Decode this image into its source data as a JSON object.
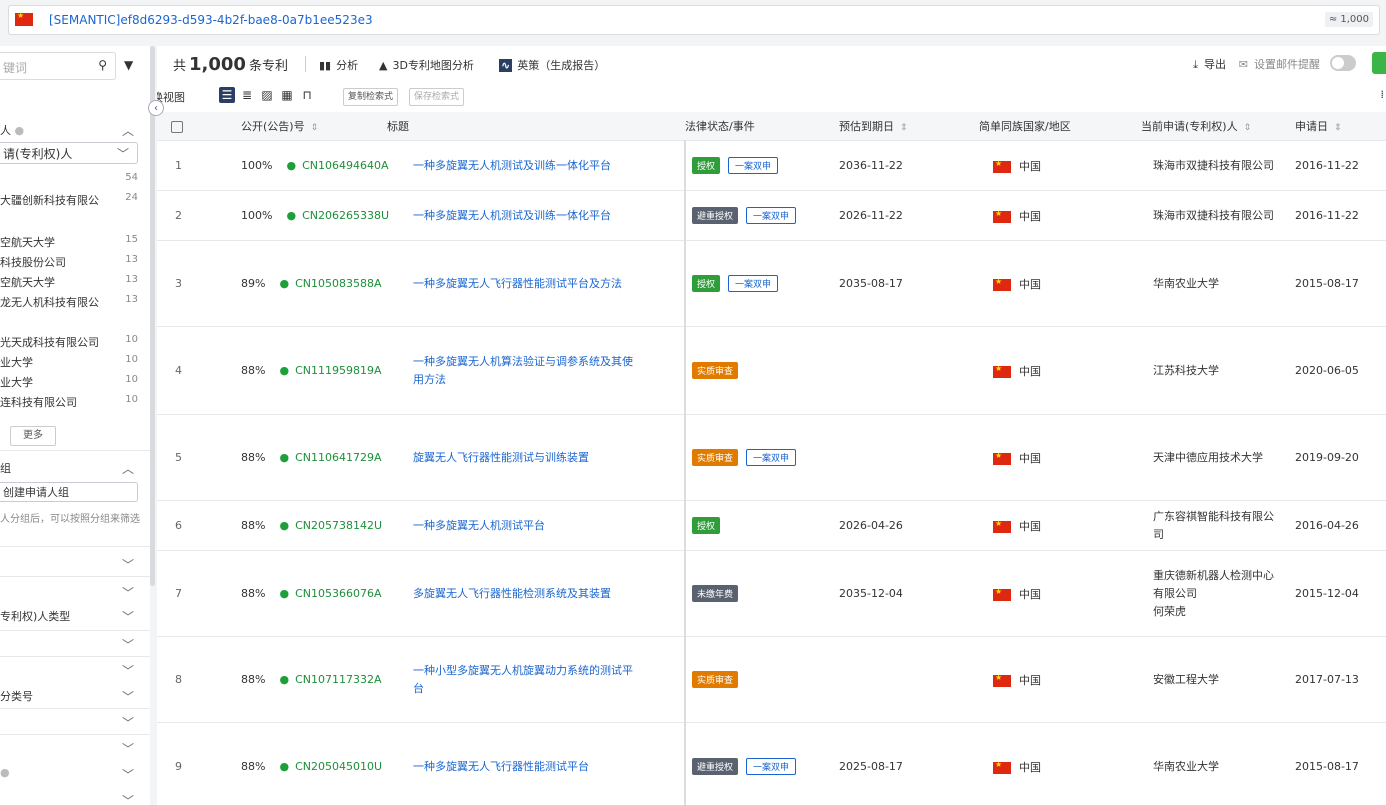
{
  "query": {
    "text": "[SEMANTIC]ef8d6293-d593-4b2f-bae8-0a7b1ee523e3",
    "count": "≈ 1,000"
  },
  "sidebar": {
    "search_placeholder": "键词",
    "section1_title": "人",
    "applicant_select": "请(专利权)人",
    "top_count": "54",
    "items": [
      {
        "label": "大疆创新科技有限公",
        "count": "24"
      },
      {
        "label": "空航天大学",
        "count": "15"
      },
      {
        "label": "科技股份公司",
        "count": "13"
      },
      {
        "label": "空航天大学",
        "count": "13"
      },
      {
        "label": "龙无人机科技有限公",
        "count": "13"
      },
      {
        "label": "光天成科技有限公司",
        "count": "10"
      },
      {
        "label": "业大学",
        "count": "10"
      },
      {
        "label": "业大学",
        "count": "10"
      },
      {
        "label": "连科技有限公司",
        "count": "10"
      }
    ],
    "more_label": "更多",
    "group_title": "组",
    "create_group": "创建申请人组",
    "group_hint": "人分组后，可以按照分组来筛选",
    "type_label": "专利权)人类型",
    "class_label": "分类号"
  },
  "toolbar": {
    "total_prefix": "共",
    "total_number": "1,000",
    "total_suffix": "条专利",
    "analysis": "分析",
    "map3d": "3D专利地图分析",
    "report": "英策（生成报告）",
    "export": "导出",
    "mail_alert": "设置邮件提醒",
    "switch_view": "切换视图",
    "copy_query": "复制检索式",
    "save_query": "保存检索式"
  },
  "table": {
    "headers": {
      "pub_no": "公开(公告)号",
      "title": "标题",
      "legal": "法律状态/事件",
      "expiry": "预估到期日",
      "country": "简单同族国家/地区",
      "applicant": "当前申请(专利权)人",
      "app_date": "申请日"
    },
    "rows": [
      {
        "idx": "1",
        "pct": "100%",
        "pn": "CN106494640A",
        "title": "一种多旋翼无人机测试及训练一体化平台",
        "status": "授权",
        "status_color": "#2f9e3a",
        "tag": "一案双申",
        "expiry": "2036-11-22",
        "country": "中国",
        "applicant": "珠海市双捷科技有限公司",
        "date": "2016-11-22"
      },
      {
        "idx": "2",
        "pct": "100%",
        "pn": "CN206265338U",
        "title": "一种多旋翼无人机测试及训练一体化平台",
        "status": "避重授权",
        "status_color": "#5a6270",
        "tag": "一案双申",
        "expiry": "2026-11-22",
        "country": "中国",
        "applicant": "珠海市双捷科技有限公司",
        "date": "2016-11-22"
      },
      {
        "idx": "3",
        "pct": "89%",
        "pn": "CN105083588A",
        "title": "一种多旋翼无人飞行器性能测试平台及方法",
        "status": "授权",
        "status_color": "#2f9e3a",
        "tag": "一案双申",
        "expiry": "2035-08-17",
        "country": "中国",
        "applicant": "华南农业大学",
        "date": "2015-08-17"
      },
      {
        "idx": "4",
        "pct": "88%",
        "pn": "CN111959819A",
        "title": "一种多旋翼无人机算法验证与调参系统及其使用方法",
        "status": "实质审查",
        "status_color": "#e07b00",
        "tag": "",
        "expiry": "",
        "country": "中国",
        "applicant": "江苏科技大学",
        "date": "2020-06-05"
      },
      {
        "idx": "5",
        "pct": "88%",
        "pn": "CN110641729A",
        "title": "旋翼无人飞行器性能测试与训练装置",
        "status": "实质审查",
        "status_color": "#e07b00",
        "tag": "一案双申",
        "expiry": "",
        "country": "中国",
        "applicant": "天津中德应用技术大学",
        "date": "2019-09-20"
      },
      {
        "idx": "6",
        "pct": "88%",
        "pn": "CN205738142U",
        "title": "一种多旋翼无人机测试平台",
        "status": "授权",
        "status_color": "#2f9e3a",
        "tag": "",
        "expiry": "2026-04-26",
        "country": "中国",
        "applicant": "广东容祺智能科技有限公司",
        "date": "2016-04-26"
      },
      {
        "idx": "7",
        "pct": "88%",
        "pn": "CN105366076A",
        "title": "多旋翼无人飞行器性能检测系统及其装置",
        "status": "未缴年费",
        "status_color": "#5a6270",
        "tag": "",
        "expiry": "2035-12-04",
        "country": "中国",
        "applicant": "重庆德新机器人检测中心有限公司\n何荣虎",
        "date": "2015-12-04"
      },
      {
        "idx": "8",
        "pct": "88%",
        "pn": "CN107117332A",
        "title": "一种小型多旋翼无人机旋翼动力系统的测试平台",
        "status": "实质审查",
        "status_color": "#e07b00",
        "tag": "",
        "expiry": "",
        "country": "中国",
        "applicant": "安徽工程大学",
        "date": "2017-07-13"
      },
      {
        "idx": "9",
        "pct": "88%",
        "pn": "CN205045010U",
        "title": "一种多旋翼无人飞行器性能测试平台",
        "status": "避重授权",
        "status_color": "#5a6270",
        "tag": "一案双申",
        "expiry": "2025-08-17",
        "country": "中国",
        "applicant": "华南农业大学",
        "date": "2015-08-17"
      }
    ]
  }
}
